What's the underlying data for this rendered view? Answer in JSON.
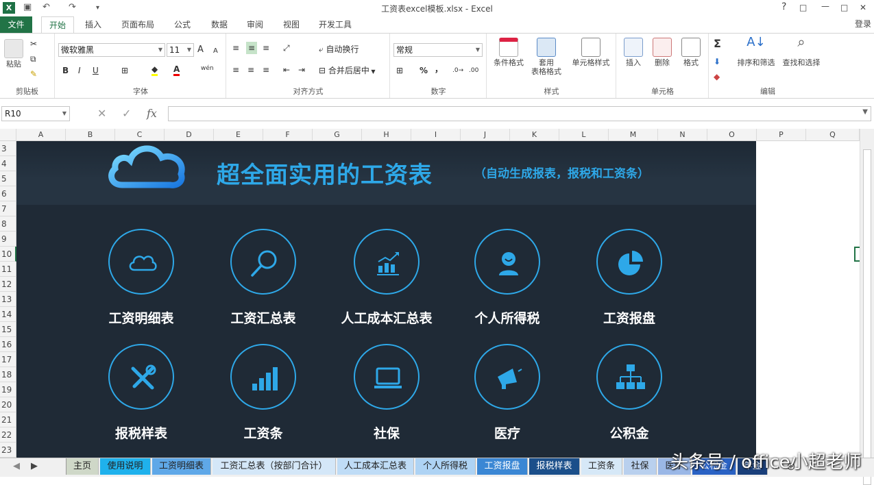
{
  "window": {
    "title": "工资表excel模板.xlsx - Excel",
    "help": "?",
    "restore": "□",
    "minimize": "—",
    "close": "✕"
  },
  "quick_access": {
    "undo": "↶",
    "redo": "↷",
    "more": "▾"
  },
  "ribbon_tabs": {
    "file": "文件",
    "items": [
      "开始",
      "插入",
      "页面布局",
      "公式",
      "数据",
      "审阅",
      "视图",
      "开发工具"
    ],
    "active_index": 0,
    "login": "登录"
  },
  "ribbon": {
    "clipboard": {
      "paste": "粘贴",
      "label": "剪贴板"
    },
    "font": {
      "name": "微软雅黑",
      "size": "11",
      "bold": "B",
      "italic": "I",
      "underline": "U",
      "label": "字体",
      "grow": "A",
      "shrink": "A",
      "wen": "wén"
    },
    "align": {
      "wrap": "自动换行",
      "merge": "合并后居中",
      "label": "对齐方式"
    },
    "number": {
      "format": "常规",
      "percent": "%",
      "comma": "，",
      "label": "数字"
    },
    "styles": {
      "cond": "条件格式",
      "table": "套用\n表格格式",
      "cell": "单元格样式",
      "label": "样式"
    },
    "cells": {
      "insert": "插入",
      "delete": "删除",
      "format": "格式",
      "label": "单元格"
    },
    "edit": {
      "sort": "排序和筛选",
      "find": "查找和选择",
      "label": "编辑",
      "sum": "Σ"
    }
  },
  "formula_bar": {
    "name_box": "R10",
    "cancel": "✕",
    "enter": "✓",
    "fx": "fx",
    "value": ""
  },
  "columns": [
    "A",
    "B",
    "C",
    "D",
    "E",
    "F",
    "G",
    "H",
    "I",
    "J",
    "K",
    "L",
    "M",
    "N",
    "O",
    "P",
    "Q"
  ],
  "rows": [
    "3",
    "4",
    "5",
    "6",
    "7",
    "8",
    "9",
    "10",
    "11",
    "12",
    "13",
    "14",
    "15",
    "16",
    "17",
    "18",
    "19",
    "20",
    "21",
    "22",
    "23"
  ],
  "dashboard": {
    "title": "超全面实用的工资表",
    "subtitle": "（自动生成报表，报税和工资条）",
    "brand_color": "#2ea8e8",
    "tiles": [
      {
        "label": "工资明细表",
        "icon": "cloud-icon"
      },
      {
        "label": "工资汇总表",
        "icon": "search-icon"
      },
      {
        "label": "人工成本汇总表",
        "icon": "chart-trend-icon"
      },
      {
        "label": "个人所得税",
        "icon": "person-icon"
      },
      {
        "label": "工资报盘",
        "icon": "pie-icon"
      },
      {
        "label": "报税样表",
        "icon": "tools-icon"
      },
      {
        "label": "工资条",
        "icon": "bars-icon"
      },
      {
        "label": "社保",
        "icon": "laptop-icon"
      },
      {
        "label": "医疗",
        "icon": "megaphone-icon"
      },
      {
        "label": "公积金",
        "icon": "org-chart-icon"
      }
    ]
  },
  "sheet_tabs": [
    "主页",
    "使用说明",
    "工资明细表",
    "工资汇总表（按部门合计）",
    "人工成本汇总表",
    "个人所得税",
    "工资报盘",
    "报税样表",
    "工资条",
    "社保",
    "医疗",
    "公积金",
    "年金"
  ],
  "sheet_more": "...",
  "watermark": "头条号 / office小超老师"
}
